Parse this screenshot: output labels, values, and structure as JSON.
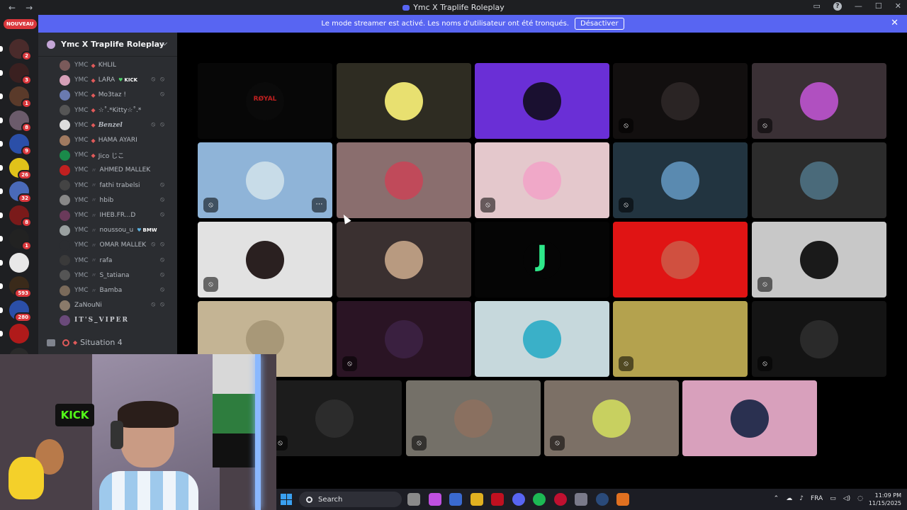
{
  "window": {
    "title": "Ymc X Traplife Roleplay",
    "back_icon": "←",
    "forward_icon": "→"
  },
  "notice": {
    "text": "Le mode streamer est activé. Les noms d'utilisateur ont été tronqués.",
    "button": "Désactiver",
    "close": "✕"
  },
  "rail": {
    "new_badge": "NOUVEAU",
    "servers": [
      {
        "color": "#4a2b2b",
        "badge": "2"
      },
      {
        "color": "#3a2020",
        "badge": "3"
      },
      {
        "color": "#5a3a2a",
        "badge": "1"
      },
      {
        "color": "#6b5b6b",
        "badge": "8"
      },
      {
        "color": "#2b4fa8",
        "badge": "9"
      },
      {
        "color": "#e0c21a",
        "badge": "26"
      },
      {
        "color": "#4a6ab8",
        "badge": "32"
      },
      {
        "color": "#7a1a1a",
        "badge": "8"
      },
      {
        "color": "#222222",
        "badge": "1"
      },
      {
        "color": "#e8e8e8",
        "badge": ""
      },
      {
        "color": "#3a2a1a",
        "badge": "593"
      },
      {
        "color": "#2b4fa8",
        "badge": "280"
      },
      {
        "color": "#b01a1a",
        "badge": ""
      },
      {
        "color": "#2a2a2a",
        "badge": "242"
      }
    ]
  },
  "sidebar": {
    "server_name": "Ymc X Traplife Roleplay",
    "chevron": "⌵",
    "members": [
      {
        "prefix": "YMC",
        "sep": "◆",
        "name": "KHLIL",
        "av": "#7a5a5a",
        "style": "",
        "tag": "",
        "icons": ""
      },
      {
        "prefix": "YMC",
        "sep": "◆",
        "name": "LARA",
        "av": "#d6a0b8",
        "style": "",
        "tag": "KICK",
        "tagcolor": "green",
        "icons": "⦸ ⦸"
      },
      {
        "prefix": "YMC",
        "sep": "◆",
        "name": "Mo3taz !",
        "av": "#6a7ab0",
        "style": "",
        "tag": "",
        "icons": "⦸"
      },
      {
        "prefix": "YMC",
        "sep": "◆",
        "name": "☆˚.*Kitty☆˚.*",
        "av": "#555555",
        "style": "",
        "tag": "",
        "icons": ""
      },
      {
        "prefix": "YMC",
        "sep": "◆",
        "name": "Benzel",
        "av": "#dddddd",
        "style": "bold",
        "tag": "",
        "icons": "⦸ ⦸"
      },
      {
        "prefix": "YMC",
        "sep": "◆",
        "name": "HAMA AYARI",
        "av": "#a07a60",
        "style": "",
        "tag": "",
        "icons": ""
      },
      {
        "prefix": "YMC",
        "sep": "◆",
        "name": "Jico じこ",
        "av": "#1a8a4a",
        "style": "",
        "tag": "",
        "icons": ""
      },
      {
        "prefix": "YMC",
        "sep": "〃",
        "name": "AHMED MALLEK",
        "av": "#c02020",
        "style": "",
        "tag": "",
        "icons": ""
      },
      {
        "prefix": "YMC",
        "sep": "〃",
        "name": "fathi trabelsi",
        "av": "#444444",
        "style": "",
        "tag": "",
        "icons": "⦸"
      },
      {
        "prefix": "YMC",
        "sep": "〃",
        "name": "hbib",
        "av": "#888888",
        "style": "",
        "tag": "",
        "icons": "⦸"
      },
      {
        "prefix": "YMC",
        "sep": "〃",
        "name": "IHEB.FR...D",
        "av": "#6a3a5a",
        "style": "",
        "tag": "",
        "icons": "⦸"
      },
      {
        "prefix": "YMC",
        "sep": "〃",
        "name": "noussou_u",
        "av": "#9aa0a0",
        "style": "",
        "tag": "BMW",
        "tagcolor": "blue",
        "icons": ""
      },
      {
        "prefix": "YMC",
        "sep": "〃",
        "name": "OMAR MALLEK",
        "av": "#2b2d31",
        "style": "",
        "tag": "",
        "icons": "⦸ ⦸"
      },
      {
        "prefix": "YMC",
        "sep": "〃",
        "name": "rafa",
        "av": "#3a3a3a",
        "style": "",
        "tag": "",
        "icons": "⦸"
      },
      {
        "prefix": "YMC",
        "sep": "〃",
        "name": "S_tatiana",
        "av": "#555555",
        "style": "",
        "tag": "",
        "icons": "⦸"
      },
      {
        "prefix": "YMC",
        "sep": "〃",
        "name": "Bamba",
        "av": "#7a6a5a",
        "style": "",
        "tag": "",
        "icons": "⦸"
      },
      {
        "prefix": "",
        "sep": "",
        "name": "ZaNouNi",
        "av": "#8a7a6a",
        "style": "",
        "tag": "",
        "icons": "⦸ ⦸"
      },
      {
        "prefix": "",
        "sep": "",
        "name": "IT'S_VIPER",
        "av": "#6a4a7a",
        "style": "spaced",
        "tag": "",
        "icons": ""
      }
    ],
    "channel": {
      "name": "Situation 4",
      "dot": "◆"
    }
  },
  "tiles": [
    {
      "bg": "#070707",
      "ava": "#0a0a0a",
      "mic": "",
      "more": false,
      "label": "RØYAL"
    },
    {
      "bg": "#2e2c22",
      "ava": "#e8e070",
      "mic": "",
      "more": false
    },
    {
      "bg": "#6a2fd6",
      "ava": "#1a1030",
      "mic": "",
      "more": false
    },
    {
      "bg": "#120f0f",
      "ava": "#2a2424",
      "mic": "⦸",
      "more": false
    },
    {
      "bg": "#3a3035",
      "ava": "#b050c0",
      "mic": "⦸",
      "more": false
    },
    {
      "bg": "#8fb4d8",
      "ava": "#c8dce8",
      "mic": "⦸",
      "more": true
    },
    {
      "bg": "#8a6e6e",
      "ava": "#c04a5a",
      "mic": "",
      "more": false
    },
    {
      "bg": "#e4c8cc",
      "ava": "#f0a8c8",
      "mic": "⦸",
      "more": false
    },
    {
      "bg": "#223440",
      "ava": "#5a8ab0",
      "mic": "⦸",
      "more": false
    },
    {
      "bg": "#2c2c2c",
      "ava": "#4a6a7a",
      "mic": "",
      "more": false
    },
    {
      "bg": "#e2e2e2",
      "ava": "#2a2020",
      "mic": "⦸",
      "more": false
    },
    {
      "bg": "#3a3030",
      "ava": "#b89a80",
      "mic": "",
      "more": false
    },
    {
      "bg": "#050505",
      "ava": "#050505",
      "mic": "",
      "more": false,
      "label": "J"
    },
    {
      "bg": "#e01414",
      "ava": "#d05040",
      "mic": "",
      "more": false
    },
    {
      "bg": "#c8c8c8",
      "ava": "#1a1a1a",
      "mic": "⦸",
      "more": false
    },
    {
      "bg": "#c4b494",
      "ava": "#a89878",
      "mic": "",
      "more": false
    },
    {
      "bg": "#2a1424",
      "ava": "#3a2040",
      "mic": "⦸",
      "more": false
    },
    {
      "bg": "#c6d8dc",
      "ava": "#3ab0c8",
      "mic": "",
      "more": false
    },
    {
      "bg": "#b4a24e",
      "ava": "#b4a24e",
      "mic": "⦸",
      "more": false
    },
    {
      "bg": "#141414",
      "ava": "#2a2a2a",
      "mic": "⦸",
      "more": false
    },
    {
      "bg": "#1c1c1c",
      "ava": "#2c2c2c",
      "mic": "⦸",
      "more": false
    },
    {
      "bg": "#747068",
      "ava": "#8a7060",
      "mic": "⦸",
      "more": false
    },
    {
      "bg": "#7c7066",
      "ava": "#c8d060",
      "mic": "⦸",
      "more": false
    },
    {
      "bg": "#d8a0bc",
      "ava": "#2a3050",
      "mic": "",
      "more": false
    }
  ],
  "webcam": {
    "sign": "KICK"
  },
  "taskbar": {
    "search": "Search",
    "apps": [
      "#8a8a8a",
      "#c050e0",
      "#3a6ad0",
      "#e0b020",
      "#c01020",
      "#5865f2",
      "#1db954",
      "#c01030",
      "#7a7a8a",
      "#2a4a7a",
      "#e07020"
    ],
    "lang": "FRA",
    "time": "11:09 PM",
    "date": "11/15/2025"
  }
}
